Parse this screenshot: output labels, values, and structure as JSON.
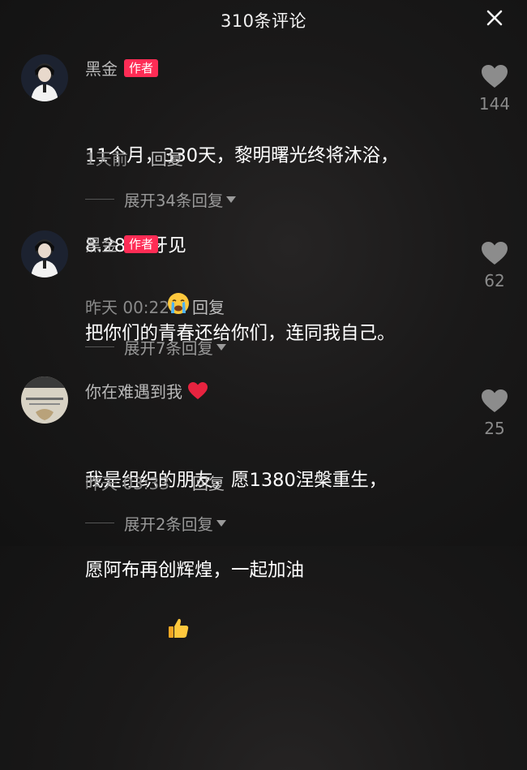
{
  "header": {
    "title": "310条评论"
  },
  "comments": [
    {
      "name": "黑金",
      "badge": "作者",
      "text_line1": "11个月，330天，黎明曙光终将沐浴，",
      "text_line2": "8.28 虎牙见",
      "emoji": "crying-face-icon",
      "time": "1天前",
      "reply": "回复",
      "likes": "144",
      "expand": "展开34条回复"
    },
    {
      "name": "黑金",
      "badge": "作者",
      "text_line1": "把你们的青春还给你们，连同我自己。",
      "time": "昨天 00:22",
      "reply": "回复",
      "likes": "62",
      "expand": "展开7条回复"
    },
    {
      "name": "你在难遇到我",
      "text_line1": "我是组织的朋友，愿1380涅槃重生，",
      "text_line2": "愿阿布再创辉煌，一起加油",
      "emoji": "thumbs-up-icon",
      "time": "昨天 03:33",
      "reply": "回复",
      "likes": "25",
      "expand": "展开2条回复"
    }
  ],
  "colors": {
    "badge": "#fe2c55",
    "background": "#151515",
    "heart_gray": "#8c8c8c"
  }
}
